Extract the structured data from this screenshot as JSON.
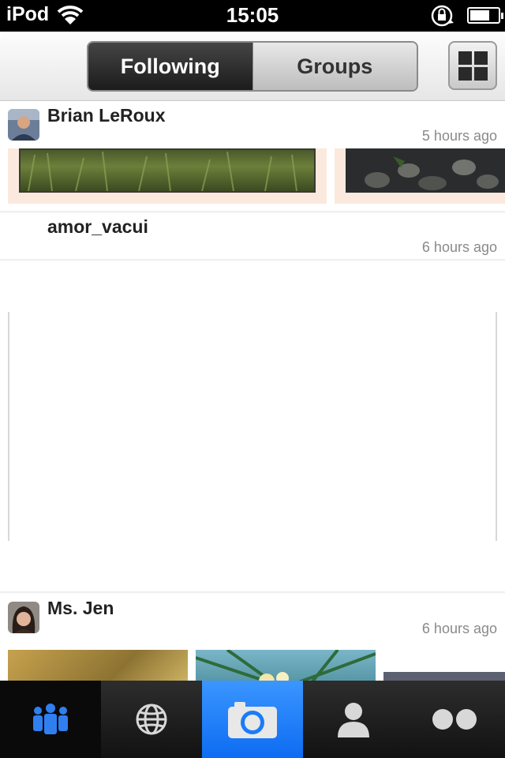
{
  "status_bar": {
    "carrier": "iPod",
    "time": "15:05"
  },
  "nav": {
    "segments": [
      {
        "label": "Following",
        "selected": true
      },
      {
        "label": "Groups",
        "selected": false
      }
    ],
    "grid_icon": "grid-view-icon"
  },
  "feed": {
    "posts": [
      {
        "username": "Brian LeRoux",
        "time": "5 hours ago"
      },
      {
        "username": "amor_vacui",
        "time": "6 hours ago"
      },
      {
        "username": "Ms. Jen",
        "time": "6 hours ago"
      }
    ]
  },
  "tab_bar": {
    "tabs": [
      {
        "icon": "people-icon",
        "selected": true
      },
      {
        "icon": "globe-icon",
        "selected": false
      },
      {
        "icon": "camera-icon",
        "selected": false
      },
      {
        "icon": "person-icon",
        "selected": false
      },
      {
        "icon": "flickr-dots-icon",
        "selected": false
      }
    ]
  },
  "colors": {
    "accent_blue": "#1a7cf7",
    "photo_frame": "#fbe9de",
    "timestamp_gray": "#8a8a8a"
  }
}
